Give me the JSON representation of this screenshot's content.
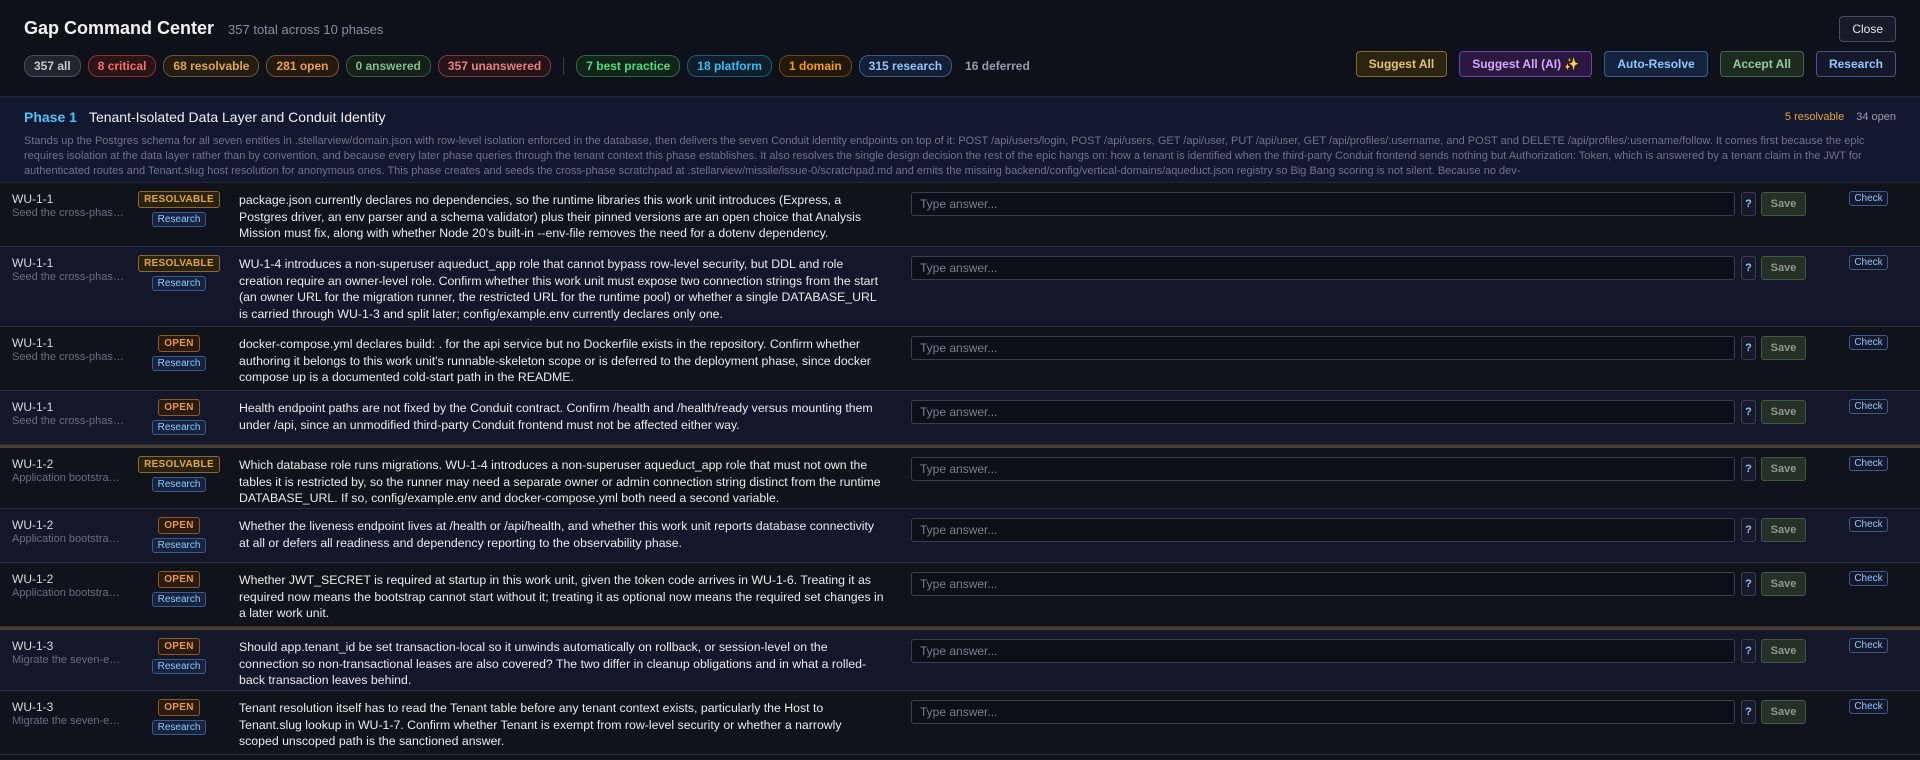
{
  "header": {
    "title": "Gap Command Center",
    "subtitle": "357 total across 10 phases",
    "close_label": "Close"
  },
  "filters": [
    {
      "label": "357 all",
      "color": "#c8c8d0",
      "border": "#4a4d5c",
      "bg": "#22242e"
    },
    {
      "label": "8 critical",
      "color": "#ff6b6b",
      "border": "#8a3030",
      "bg": "#2a1416"
    },
    {
      "label": "68 resolvable",
      "color": "#e0a83a",
      "border": "#6a5430",
      "bg": "#221c12"
    },
    {
      "label": "281 open",
      "color": "#f0a040",
      "border": "#7a5028",
      "bg": "#241a10"
    },
    {
      "label": "0 answered",
      "color": "#7fbf8a",
      "border": "#3a5a40",
      "bg": "#152018"
    },
    {
      "label": "357 unanswered",
      "color": "#e88080",
      "border": "#7a3a40",
      "bg": "#241418"
    }
  ],
  "filters2": [
    {
      "label": "7 best practice",
      "color": "#4ade80",
      "border": "#2a6a40",
      "bg": "#10241a"
    },
    {
      "label": "18 platform",
      "color": "#38bdf8",
      "border": "#205a7a",
      "bg": "#0e1e2a"
    },
    {
      "label": "1 domain",
      "color": "#f59e0b",
      "border": "#6a4a10",
      "bg": "#22180a"
    },
    {
      "label": "315 research",
      "color": "#93c5fd",
      "border": "#3a5a8a",
      "bg": "#141e34"
    }
  ],
  "deferred_label": "16 deferred",
  "actions": [
    {
      "label": "Suggest All",
      "color": "#e8c468",
      "border": "#8a6a2a",
      "bg": "#2a2410"
    },
    {
      "label": "Suggest All (AI) ✨",
      "color": "#d8a8ff",
      "border": "#7a3ab0",
      "bg": "#2a1840"
    },
    {
      "label": "Auto-Resolve",
      "color": "#8cc8ff",
      "border": "#3a5a8a",
      "bg": "#16233f"
    },
    {
      "label": "Accept All",
      "color": "#9ac8a0",
      "border": "#3c6a44",
      "bg": "#1c2a20"
    },
    {
      "label": "Research",
      "color": "#8cc8ff",
      "border": "#3a5a8a",
      "bg": "#14182a"
    }
  ],
  "phase": {
    "label": "Phase 1",
    "title": "Tenant-Isolated Data Layer and Conduit Identity",
    "resolvable": "5 resolvable",
    "open": "34 open",
    "description": "Stands up the Postgres schema for all seven entities in .stellarview/domain.json with row-level isolation enforced in the database, then delivers the seven Conduit identity endpoints on top of it: POST /api/users/login, POST /api/users, GET /api/user, PUT /api/user, GET /api/profiles/:username, and POST and DELETE /api/profiles/:username/follow. It comes first because the epic requires isolation at the data layer rather than by convention, and because every later phase queries through the tenant context this phase establishes. It also resolves the single design decision the rest of the epic hangs on: how a tenant is identified when the third-party Conduit frontend sends nothing but Authorization: Token, which is answered by a tenant claim in the JWT for authenticated routes and Tenant.slug host resolution for anonymous ones. This phase creates and seeds the cross-phase scratchpad at .stellarview/missile/issue-0/scratchpad.md and emits the missing backend/config/vertical-domains/aqueduct.json registry so Big Bang scoring is not silent. Because no dev-"
  },
  "answer_placeholder": "Type answer...",
  "q_label": "?",
  "save_label": "Save",
  "check_label": "Check",
  "research_label": "Research",
  "rows": [
    {
      "wu": "WU-1-1",
      "wu_desc": "Seed the cross-phase scratchpad",
      "status": "RESOLVABLE",
      "question": "package.json currently declares no dependencies, so the runtime libraries this work unit introduces (Express, a Postgres driver, an env parser and a schema validator) plus their pinned versions are an open choice that Analysis Mission must fix, along with whether Node 20's built-in --env-file removes the need for a dotenv dependency."
    },
    {
      "wu": "WU-1-1",
      "wu_desc": "Seed the cross-phase scratchpad",
      "status": "RESOLVABLE",
      "question": "WU-1-4 introduces a non-superuser aqueduct_app role that cannot bypass row-level security, but DDL and role creation require an owner-level role. Confirm whether this work unit must expose two connection strings from the start (an owner URL for the migration runner, the restricted URL for the runtime pool) or whether a single DATABASE_URL is carried through WU-1-3 and split later; config/example.env currently declares only one."
    },
    {
      "wu": "WU-1-1",
      "wu_desc": "Seed the cross-phase scratchpad",
      "status": "OPEN",
      "question": "docker-compose.yml declares build: . for the api service but no Dockerfile exists in the repository. Confirm whether authoring it belongs to this work unit's runnable-skeleton scope or is deferred to the deployment phase, since docker compose up is a documented cold-start path in the README."
    },
    {
      "wu": "WU-1-1",
      "wu_desc": "Seed the cross-phase scratchpad",
      "status": "OPEN",
      "question": "Health endpoint paths are not fixed by the Conduit contract. Confirm /health and /health/ready versus mounting them under /api, since an unmodified third-party Conduit frontend must not be affected either way."
    },
    {
      "wu": "WU-1-2",
      "wu_desc": "Application bootstrap and config",
      "status": "RESOLVABLE",
      "question": "Which database role runs migrations. WU-1-4 introduces a non-superuser aqueduct_app role that must not own the tables it is restricted by, so the runner may need a separate owner or admin connection string distinct from the runtime DATABASE_URL. If so, config/example.env and docker-compose.yml both need a second variable."
    },
    {
      "wu": "WU-1-2",
      "wu_desc": "Application bootstrap and config",
      "status": "OPEN",
      "question": "Whether the liveness endpoint lives at /health or /api/health, and whether this work unit reports database connectivity at all or defers all readiness and dependency reporting to the observability phase."
    },
    {
      "wu": "WU-1-2",
      "wu_desc": "Application bootstrap and config",
      "status": "OPEN",
      "question": "Whether JWT_SECRET is required at startup in this work unit, given the token code arrives in WU-1-6. Treating it as required now means the bootstrap cannot start without it; treating it as optional now means the required set changes in a later work unit."
    },
    {
      "wu": "WU-1-3",
      "wu_desc": "Migrate the seven-entity schema",
      "status": "OPEN",
      "question": "Should app.tenant_id be set transaction-local so it unwinds automatically on rollback, or session-level on the connection so non-transactional leases are also covered? The two differ in cleanup obligations and in what a rolled-back transaction leaves behind."
    },
    {
      "wu": "WU-1-3",
      "wu_desc": "Migrate the seven-entity schema",
      "status": "OPEN",
      "question": "Tenant resolution itself has to read the Tenant table before any tenant context exists, particularly the Host to Tenant.slug lookup in WU-1-7. Confirm whether Tenant is exempt from row-level security or whether a narrowly scoped unscoped path is the sanctioned answer."
    }
  ]
}
